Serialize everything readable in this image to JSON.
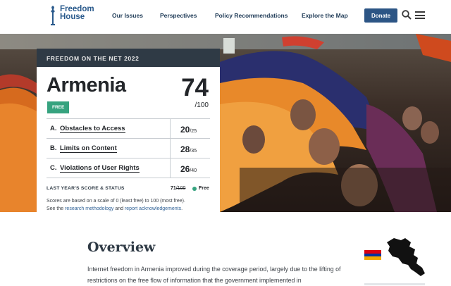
{
  "header": {
    "logo_line1": "Freedom",
    "logo_line2": "House",
    "nav": [
      "Our Issues",
      "Perspectives",
      "Policy Recommendations",
      "Explore the Map"
    ],
    "donate_label": "Donate"
  },
  "card": {
    "report_title": "FREEDOM ON THE NET 2022",
    "country": "Armenia",
    "status": "FREE",
    "total_score": "74",
    "total_max": "/100",
    "categories": [
      {
        "letter": "A.",
        "name": "Obstacles to Access",
        "score": "20",
        "max": "/25"
      },
      {
        "letter": "B.",
        "name": "Limits on Content",
        "score": "28",
        "max": "/35"
      },
      {
        "letter": "C.",
        "name": "Violations of User Rights",
        "score": "26",
        "max": "/40"
      }
    ],
    "last_year_label": "LAST YEAR'S SCORE & STATUS",
    "last_year_score": "71",
    "last_year_max": "/100",
    "last_year_status": "Free",
    "note_line1": "Scores are based on a scale of 0 (least free) to 100 (most free).",
    "note_see": "See the",
    "note_link1": "research methodology",
    "note_and": "and",
    "note_link2": "report acknowledgements",
    "note_end": "."
  },
  "overview": {
    "title": "Overview",
    "text": "Internet freedom in Armenia improved during the coverage period, largely due to the lifting of restrictions on the free flow of information that the government implemented in"
  },
  "colors": {
    "brand_blue": "#2c5585",
    "free_green": "#36a37f",
    "card_header": "#2f3a45",
    "flag_red": "#d90012",
    "flag_blue": "#0033a0",
    "flag_orange": "#f2a800"
  }
}
